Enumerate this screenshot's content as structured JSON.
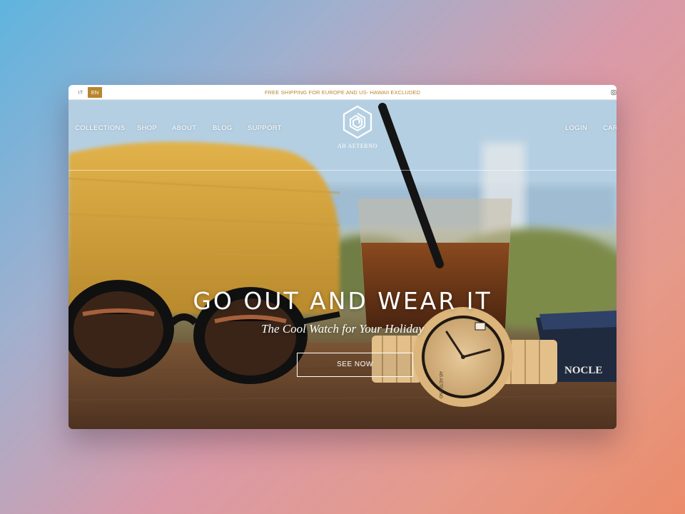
{
  "topbar": {
    "languages": [
      {
        "code": "IT",
        "active": false
      },
      {
        "code": "EN",
        "active": true
      }
    ],
    "promo_text": "FREE SHIPPING FOR EUROPE AND US- HAWAII EXCLUDED",
    "accent_color": "#b8862e"
  },
  "nav": {
    "left_items": [
      "COLLECTIONS",
      "SHOP",
      "ABOUT",
      "BLOG",
      "SUPPORT"
    ],
    "right_items": [
      "LOGIN",
      "CART"
    ]
  },
  "brand": {
    "name": "AB AETERNO",
    "logo_icon": "hexagon-spiral-logo"
  },
  "hero": {
    "headline": "GO OUT AND WEAR IT",
    "subheadline": "The Cool Watch for Your Holiday",
    "cta_label": "SEE NOW",
    "book_text": "NOCLE",
    "watch_text": "AB AETERNO"
  }
}
